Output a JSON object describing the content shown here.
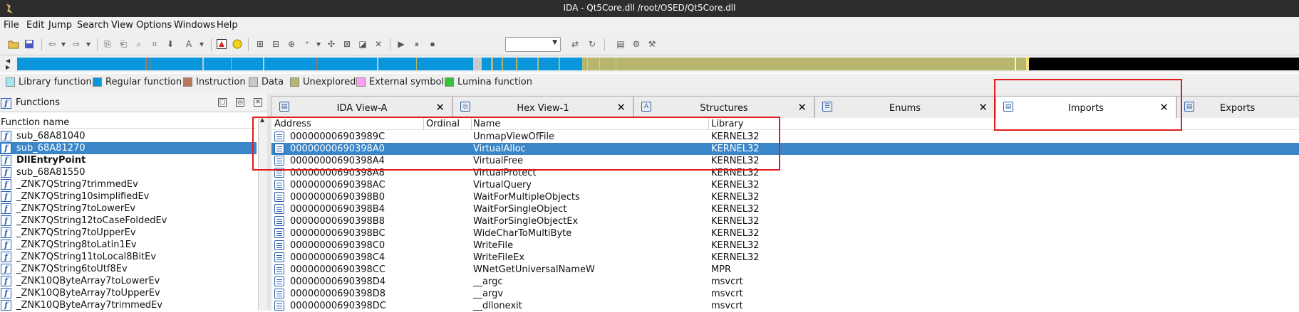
{
  "window": {
    "title": "IDA - Qt5Core.dll /root/OSED/Qt5Core.dll"
  },
  "menu": [
    "File",
    "Edit",
    "Jump",
    "Search",
    "View",
    "Options",
    "Windows",
    "Help"
  ],
  "legend": [
    {
      "label": "Library function",
      "color": "#9ee8f0"
    },
    {
      "label": "Regular function",
      "color": "#0a96dd"
    },
    {
      "label": "Instruction",
      "color": "#b6795a"
    },
    {
      "label": "Data",
      "color": "#c8c8c8"
    },
    {
      "label": "Unexplored",
      "color": "#b8b66c"
    },
    {
      "label": "External symbol",
      "color": "#ff9ff3"
    },
    {
      "label": "Lumina function",
      "color": "#35c435"
    }
  ],
  "functions_panel": {
    "title": "Functions",
    "column_header": "Function name",
    "items": [
      {
        "name": "sub_68A81040"
      },
      {
        "name": "sub_68A81270",
        "selected": true
      },
      {
        "name": "DllEntryPoint",
        "bold": true
      },
      {
        "name": "sub_68A81550"
      },
      {
        "name": "_ZNK7QString7trimmedEv"
      },
      {
        "name": "_ZNK7QString10simplifiedEv"
      },
      {
        "name": "_ZNK7QString7toLowerEv"
      },
      {
        "name": "_ZNK7QString12toCaseFoldedEv"
      },
      {
        "name": "_ZNK7QString7toUpperEv"
      },
      {
        "name": "_ZNK7QString8toLatin1Ev"
      },
      {
        "name": "_ZNK7QString11toLocal8BitEv"
      },
      {
        "name": "_ZNK7QString6toUtf8Ev"
      },
      {
        "name": "_ZNK10QByteArray7toLowerEv"
      },
      {
        "name": "_ZNK10QByteArray7toUpperEv"
      },
      {
        "name": "_ZNK10QByteArray7trimmedEv"
      }
    ]
  },
  "tabs": [
    {
      "label": "IDA View-A"
    },
    {
      "label": "Hex View-1"
    },
    {
      "label": "Structures"
    },
    {
      "label": "Enums"
    },
    {
      "label": "Imports",
      "active": true
    },
    {
      "label": "Exports"
    }
  ],
  "imports": {
    "columns": [
      "Address",
      "Ordinal",
      "Name",
      "Library"
    ],
    "rows": [
      {
        "address": "000000006903989C",
        "ordinal": "",
        "name": "UnmapViewOfFile",
        "library": "KERNEL32"
      },
      {
        "address": "00000000690398A0",
        "ordinal": "",
        "name": "VirtualAlloc",
        "library": "KERNEL32",
        "selected": true
      },
      {
        "address": "00000000690398A4",
        "ordinal": "",
        "name": "VirtualFree",
        "library": "KERNEL32"
      },
      {
        "address": "00000000690398A8",
        "ordinal": "",
        "name": "VirtualProtect",
        "library": "KERNEL32"
      },
      {
        "address": "00000000690398AC",
        "ordinal": "",
        "name": "VirtualQuery",
        "library": "KERNEL32"
      },
      {
        "address": "00000000690398B0",
        "ordinal": "",
        "name": "WaitForMultipleObjects",
        "library": "KERNEL32"
      },
      {
        "address": "00000000690398B4",
        "ordinal": "",
        "name": "WaitForSingleObject",
        "library": "KERNEL32"
      },
      {
        "address": "00000000690398B8",
        "ordinal": "",
        "name": "WaitForSingleObjectEx",
        "library": "KERNEL32"
      },
      {
        "address": "00000000690398BC",
        "ordinal": "",
        "name": "WideCharToMultiByte",
        "library": "KERNEL32"
      },
      {
        "address": "00000000690398C0",
        "ordinal": "",
        "name": "WriteFile",
        "library": "KERNEL32"
      },
      {
        "address": "00000000690398C4",
        "ordinal": "",
        "name": "WriteFileEx",
        "library": "KERNEL32"
      },
      {
        "address": "00000000690398CC",
        "ordinal": "",
        "name": "WNetGetUniversalNameW",
        "library": "MPR"
      },
      {
        "address": "00000000690398D4",
        "ordinal": "",
        "name": "__argc",
        "library": "msvcrt"
      },
      {
        "address": "00000000690398D8",
        "ordinal": "",
        "name": "__argv",
        "library": "msvcrt"
      },
      {
        "address": "00000000690398DC",
        "ordinal": "",
        "name": "__dllonexit",
        "library": "msvcrt"
      }
    ]
  },
  "toolbar": {
    "icons": [
      "open-icon",
      "save-icon",
      "back-icon",
      "forward-icon",
      "copy-icon",
      "paste-icon",
      "search-text-icon",
      "search-binary-icon",
      "jump-down-icon",
      "text-icon",
      "graph-icon",
      "lumina-icon",
      "function-icon",
      "code-icon",
      "data-icon",
      "string-icon",
      "struct-icon",
      "enum-icon",
      "undefine-icon",
      "play-icon",
      "pause-icon",
      "stop-icon",
      "debugger-combo",
      "attach-icon",
      "step-icon",
      "imports-icon",
      "hexrays-icon",
      "tools-icon"
    ]
  },
  "annotations": {
    "color": "#e21b1b"
  }
}
